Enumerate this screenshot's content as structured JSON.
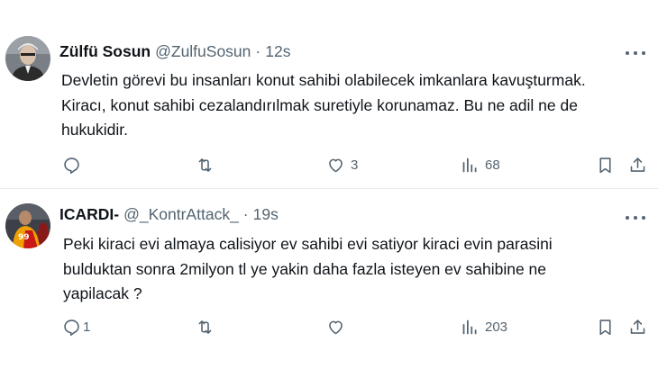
{
  "tweets": [
    {
      "name": "Zülfü Sosun",
      "handle": "@ZulfuSosun",
      "separator": "·",
      "time": "12s",
      "text_lines": [
        "Devletin görevi bu insanları konut sahibi olabilecek imkanlara kavuşturmak.",
        "Kiracı, konut sahibi cezalandırılmak suretiyle korunamaz. Bu ne adil ne de",
        "hukukidir."
      ],
      "replies": "",
      "retweets": "",
      "likes": "3",
      "views": "68",
      "icons": [
        "reply-icon",
        "retweet-icon",
        "like-icon",
        "views-icon",
        "bookmark-icon",
        "share-icon",
        "more-icon"
      ]
    },
    {
      "name": "ICARDI-",
      "handle": "@_KontrAttack_",
      "separator": "·",
      "time": "19s",
      "text_lines": [
        "Peki kiraci evi almaya calisiyor ev sahibi evi satiyor kiraci evin parasini",
        "bulduktan sonra 2milyon tl ye yakin daha fazla isteyen ev sahibine ne",
        "yapilacak ?"
      ],
      "replies": "1",
      "retweets": "",
      "likes": "",
      "views": "203",
      "icons": [
        "reply-icon",
        "retweet-icon",
        "like-icon",
        "views-icon",
        "bookmark-icon",
        "share-icon",
        "more-icon"
      ]
    }
  ],
  "colors": {
    "text": "#0f1419",
    "secondary": "#536471",
    "divider": "#e6e9ec",
    "background": "#ffffff"
  }
}
